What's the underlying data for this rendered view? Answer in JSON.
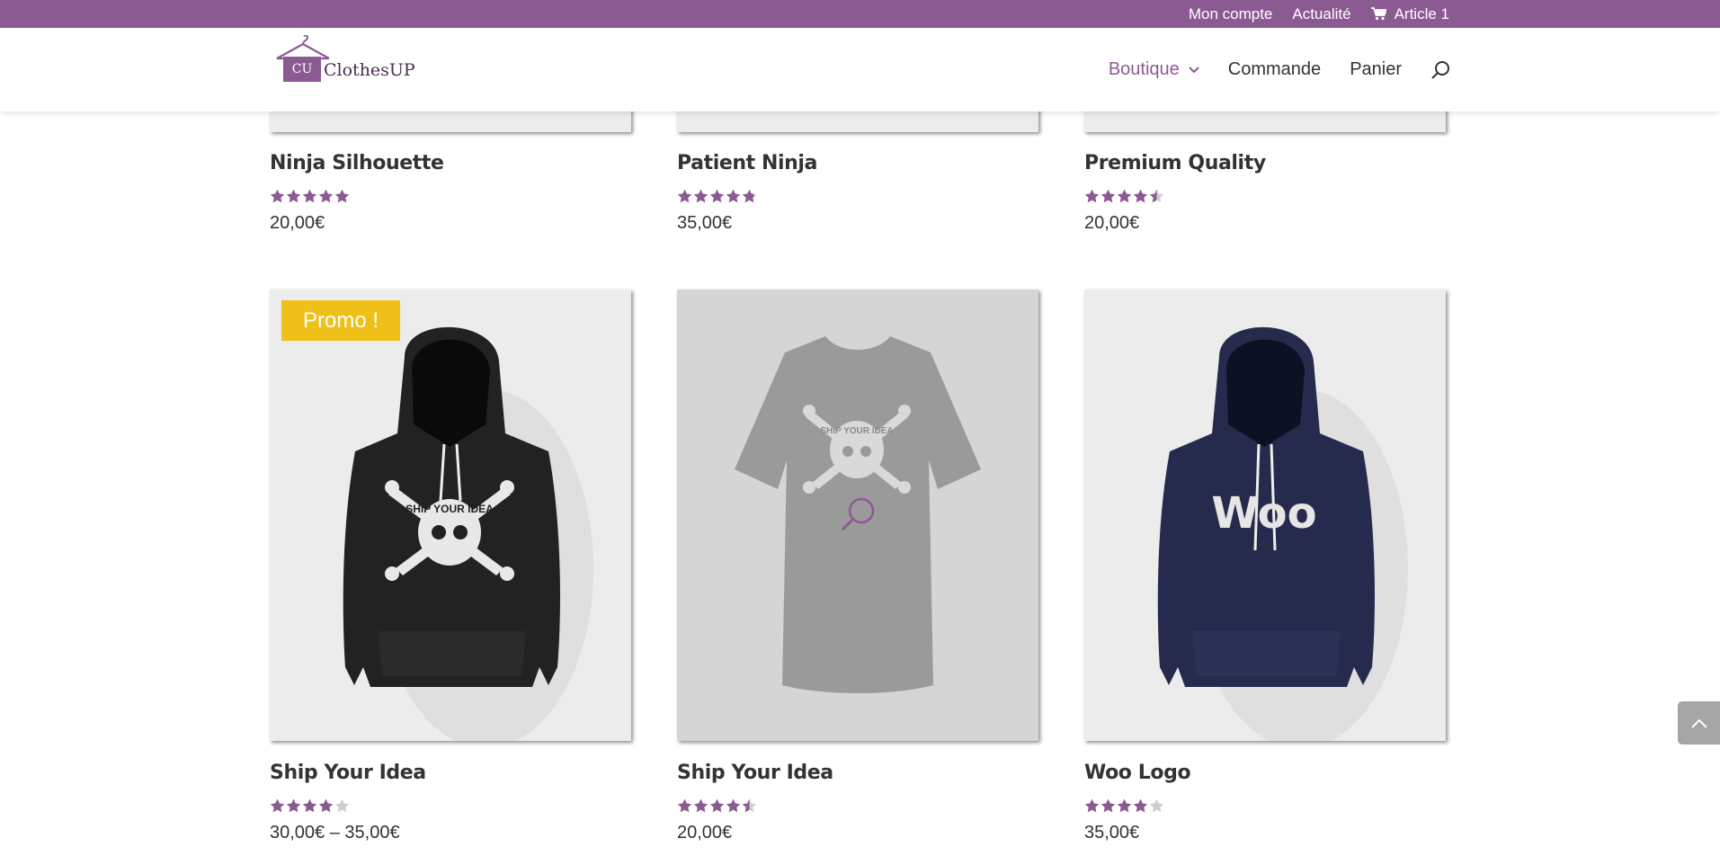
{
  "topbar": {
    "my_account": "Mon compte",
    "news": "Actualité",
    "cart": "Article 1"
  },
  "brand": {
    "name": "ClothesUP",
    "monogram": "CU"
  },
  "nav": {
    "shop": "Boutique",
    "order": "Commande",
    "basket": "Panier"
  },
  "colors": {
    "accent": "#8c5a93",
    "sale": "#efc018",
    "star_empty": "#cfcfcf"
  },
  "products": [
    {
      "title": "Ninja Silhouette",
      "rating": 5,
      "price": "20,00€"
    },
    {
      "title": "Patient Ninja",
      "rating": 4.8,
      "price": "35,00€"
    },
    {
      "title": "Premium Quality",
      "rating": 4.5,
      "price": "20,00€"
    },
    {
      "title": "Ship Your Idea",
      "rating": 4,
      "price": "30,00€ – 35,00€",
      "badge": "Promo !",
      "image": "black-hoodie-skull"
    },
    {
      "title": "Ship Your Idea",
      "rating": 4.5,
      "price": "20,00€",
      "image": "gray-tshirt-skull"
    },
    {
      "title": "Woo Logo",
      "rating": 4,
      "price": "35,00€",
      "image": "navy-hoodie-woo",
      "print": "Woo"
    }
  ],
  "tshirt_print": "SHIP YOUR IDEA"
}
